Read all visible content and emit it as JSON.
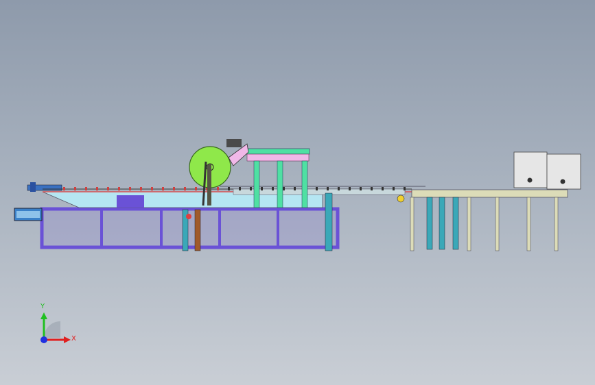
{
  "viewport": {
    "background_top": "#8e9aab",
    "background_bottom": "#c9ced5"
  },
  "model": {
    "frame_color": "#6a52d6",
    "bed_color": "#b5e6f2",
    "green_color": "#4fe0a3",
    "drum_color": "#8fe84a",
    "pink_color": "#f0b8e8",
    "table_color": "#dcdcb8",
    "box_color": "#e6e6e6",
    "leg_teal": "#3aa8b8",
    "accent_red": "#e04040"
  },
  "triad": {
    "x_label": "X",
    "y_label": "Y",
    "x_color": "#e02020",
    "y_color": "#20c020",
    "z_color": "#2030e0",
    "x_icon": "axis-x-arrow-icon",
    "y_icon": "axis-y-arrow-icon",
    "z_icon": "axis-z-origin-icon"
  }
}
